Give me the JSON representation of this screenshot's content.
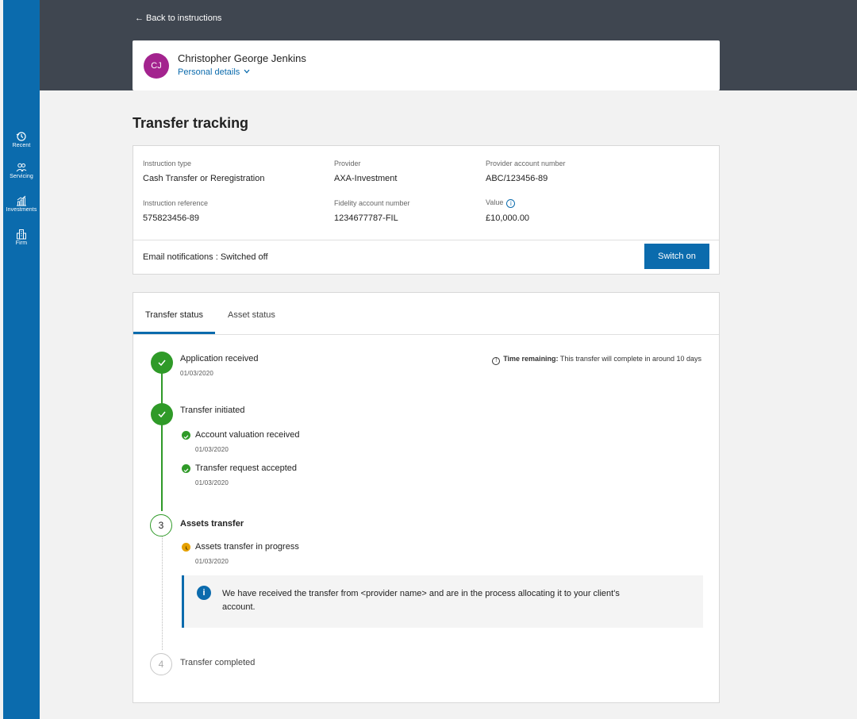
{
  "sidebar": {
    "items": [
      {
        "label": "Recent",
        "icon": "history-icon"
      },
      {
        "label": "Servicing",
        "icon": "people-icon"
      },
      {
        "label": "Investments",
        "icon": "chart-icon"
      },
      {
        "label": "Firm",
        "icon": "building-icon"
      }
    ]
  },
  "header": {
    "back_link": "← Back to instructions",
    "client": {
      "initials": "CJ",
      "name": "Christopher George Jenkins",
      "personal_details_link": "Personal details"
    }
  },
  "page": {
    "title": "Transfer tracking"
  },
  "summary": {
    "instruction_type_label": "Instruction type",
    "instruction_type": "Cash Transfer or Reregistration",
    "provider_label": "Provider",
    "provider": "AXA-Investment",
    "provider_account_label": "Provider account number",
    "provider_account": "ABC/123456-89",
    "instruction_reference_label": "Instruction reference",
    "instruction_reference": "575823456-89",
    "fidelity_account_label": "Fidelity account number",
    "fidelity_account": "1234677787-FIL",
    "value_label": "Value",
    "value": "£10,000.00",
    "email_notifications": "Email notifications : Switched off",
    "switch_button": "Switch on"
  },
  "tracking": {
    "tabs": [
      {
        "label": "Transfer status",
        "active": true
      },
      {
        "label": "Asset status",
        "active": false
      }
    ],
    "time_remaining_label": "Time remaining:",
    "time_remaining_text": "This transfer will complete in around 10 days",
    "steps": [
      {
        "title": "Application received",
        "date": "01/03/2020",
        "state": "done"
      },
      {
        "title": "Transfer initiated",
        "state": "done",
        "substeps": [
          {
            "title": "Account valuation received",
            "date": "01/03/2020",
            "state": "done"
          },
          {
            "title": "Transfer request accepted",
            "date": "01/03/2020",
            "state": "done"
          }
        ]
      },
      {
        "number": "3",
        "title": "Assets transfer",
        "state": "current",
        "substeps": [
          {
            "title": "Assets transfer in progress",
            "date": "01/03/2020",
            "state": "in-progress"
          }
        ]
      },
      {
        "number": "4",
        "title": "Transfer completed",
        "state": "future"
      }
    ],
    "info_message": "We have received the transfer from <provider name> and are in the process allocating it to your client's account."
  },
  "colors": {
    "primary_blue": "#0b6bad",
    "header_dark": "#3f4650",
    "success_green": "#2f9a28",
    "progress_amber": "#e6a100",
    "avatar_purple": "#a3238e"
  }
}
